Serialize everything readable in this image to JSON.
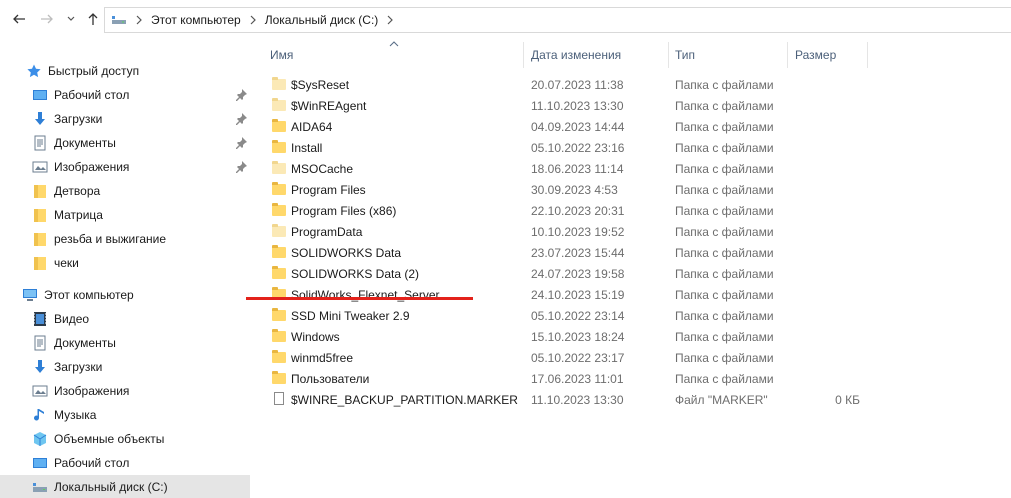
{
  "address": {
    "crumbs": [
      "Этот компьютер",
      "Локальный диск (C:)"
    ]
  },
  "sidebar": {
    "quick_access": "Быстрый доступ",
    "quick_items": [
      {
        "label": "Рабочий стол",
        "icon": "desktop-icon",
        "pinned": true
      },
      {
        "label": "Загрузки",
        "icon": "downloads-icon",
        "pinned": true
      },
      {
        "label": "Документы",
        "icon": "documents-icon",
        "pinned": true
      },
      {
        "label": "Изображения",
        "icon": "pictures-icon",
        "pinned": true
      },
      {
        "label": "Детвора",
        "icon": "folder-icon",
        "pinned": false
      },
      {
        "label": "Матрица",
        "icon": "folder-icon",
        "pinned": false
      },
      {
        "label": "резьба и выжигание",
        "icon": "folder-icon",
        "pinned": false
      },
      {
        "label": "чеки",
        "icon": "folder-icon",
        "pinned": false
      }
    ],
    "this_pc": "Этот компьютер",
    "pc_items": [
      {
        "label": "Видео",
        "icon": "video-icon"
      },
      {
        "label": "Документы",
        "icon": "documents-icon"
      },
      {
        "label": "Загрузки",
        "icon": "downloads-icon"
      },
      {
        "label": "Изображения",
        "icon": "pictures-icon"
      },
      {
        "label": "Музыка",
        "icon": "music-icon"
      },
      {
        "label": "Объемные объекты",
        "icon": "3d-objects-icon"
      },
      {
        "label": "Рабочий стол",
        "icon": "desktop-icon"
      },
      {
        "label": "Локальный диск (C:)",
        "icon": "drive-icon",
        "selected": true
      }
    ]
  },
  "columns": {
    "name": "Имя",
    "date": "Дата изменения",
    "type": "Тип",
    "size": "Размер"
  },
  "files": [
    {
      "name": "$SysReset",
      "date": "20.07.2023 11:38",
      "type": "Папка с файлами",
      "size": "",
      "kind": "folder-pale"
    },
    {
      "name": "$WinREAgent",
      "date": "11.10.2023 13:30",
      "type": "Папка с файлами",
      "size": "",
      "kind": "folder-pale"
    },
    {
      "name": "AIDA64",
      "date": "04.09.2023 14:44",
      "type": "Папка с файлами",
      "size": "",
      "kind": "folder"
    },
    {
      "name": "Install",
      "date": "05.10.2022 23:16",
      "type": "Папка с файлами",
      "size": "",
      "kind": "folder"
    },
    {
      "name": "MSOCache",
      "date": "18.06.2023 11:14",
      "type": "Папка с файлами",
      "size": "",
      "kind": "folder-pale"
    },
    {
      "name": "Program Files",
      "date": "30.09.2023 4:53",
      "type": "Папка с файлами",
      "size": "",
      "kind": "folder"
    },
    {
      "name": "Program Files (x86)",
      "date": "22.10.2023 20:31",
      "type": "Папка с файлами",
      "size": "",
      "kind": "folder"
    },
    {
      "name": "ProgramData",
      "date": "10.10.2023 19:52",
      "type": "Папка с файлами",
      "size": "",
      "kind": "folder-pale"
    },
    {
      "name": "SOLIDWORKS Data",
      "date": "23.07.2023 15:44",
      "type": "Папка с файлами",
      "size": "",
      "kind": "folder"
    },
    {
      "name": "SOLIDWORKS Data (2)",
      "date": "24.07.2023 19:58",
      "type": "Папка с файлами",
      "size": "",
      "kind": "folder"
    },
    {
      "name": "SolidWorks_Flexnet_Server",
      "date": "24.10.2023 15:19",
      "type": "Папка с файлами",
      "size": "",
      "kind": "folder"
    },
    {
      "name": "SSD Mini Tweaker 2.9",
      "date": "05.10.2022 23:14",
      "type": "Папка с файлами",
      "size": "",
      "kind": "folder"
    },
    {
      "name": "Windows",
      "date": "15.10.2023 18:24",
      "type": "Папка с файлами",
      "size": "",
      "kind": "folder"
    },
    {
      "name": "winmd5free",
      "date": "05.10.2022 23:17",
      "type": "Папка с файлами",
      "size": "",
      "kind": "folder"
    },
    {
      "name": "Пользователи",
      "date": "17.06.2023 11:01",
      "type": "Папка с файлами",
      "size": "",
      "kind": "folder"
    },
    {
      "name": "$WINRE_BACKUP_PARTITION.MARKER",
      "date": "11.10.2023 13:30",
      "type": "Файл \"MARKER\"",
      "size": "0 КБ",
      "kind": "file"
    }
  ],
  "colors": {
    "annotation_line": "#e3221b",
    "folder": "#ffd86b",
    "header_text": "#4c607a"
  }
}
